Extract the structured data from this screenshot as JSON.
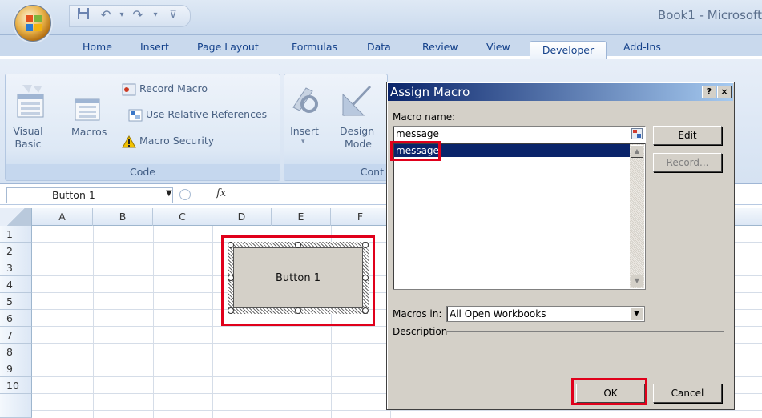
{
  "window": {
    "title": "Book1 - Microsoft"
  },
  "tabs": [
    "Home",
    "Insert",
    "Page Layout",
    "Formulas",
    "Data",
    "Review",
    "View",
    "Developer",
    "Add-Ins"
  ],
  "ribbon": {
    "code_group": {
      "label": "Code",
      "visual_basic": "Visual\nBasic",
      "macros": "Macros",
      "record_macro": "Record Macro",
      "use_relative": "Use Relative References",
      "macro_security": "Macro Security"
    },
    "controls_group": {
      "label": "Cont",
      "insert": "Insert",
      "design_mode": "Design\nMode"
    }
  },
  "formula_bar": {
    "name_box": "Button 1",
    "fx": "fx"
  },
  "sheet": {
    "columns": [
      "A",
      "B",
      "C",
      "D",
      "E",
      "F"
    ],
    "rows": [
      "1",
      "2",
      "3",
      "4",
      "5",
      "6",
      "7",
      "8",
      "9",
      "10"
    ],
    "button_label": "Button 1"
  },
  "dialog": {
    "title": "Assign Macro",
    "help": "?",
    "close": "×",
    "macro_name_label": "Macro name:",
    "macro_name_value": "message",
    "macros": [
      "message"
    ],
    "selected_index": 0,
    "macros_in_label": "Macros in:",
    "macros_in_value": "All Open Workbooks",
    "description_label": "Description",
    "edit": "Edit",
    "record": "Record...",
    "ok": "OK",
    "cancel": "Cancel"
  },
  "colors": {
    "ribbon": "#dbe6f4",
    "dialog": "#d4d0c8",
    "dialog_title": "#0a246a",
    "highlight": "#e0001b"
  }
}
